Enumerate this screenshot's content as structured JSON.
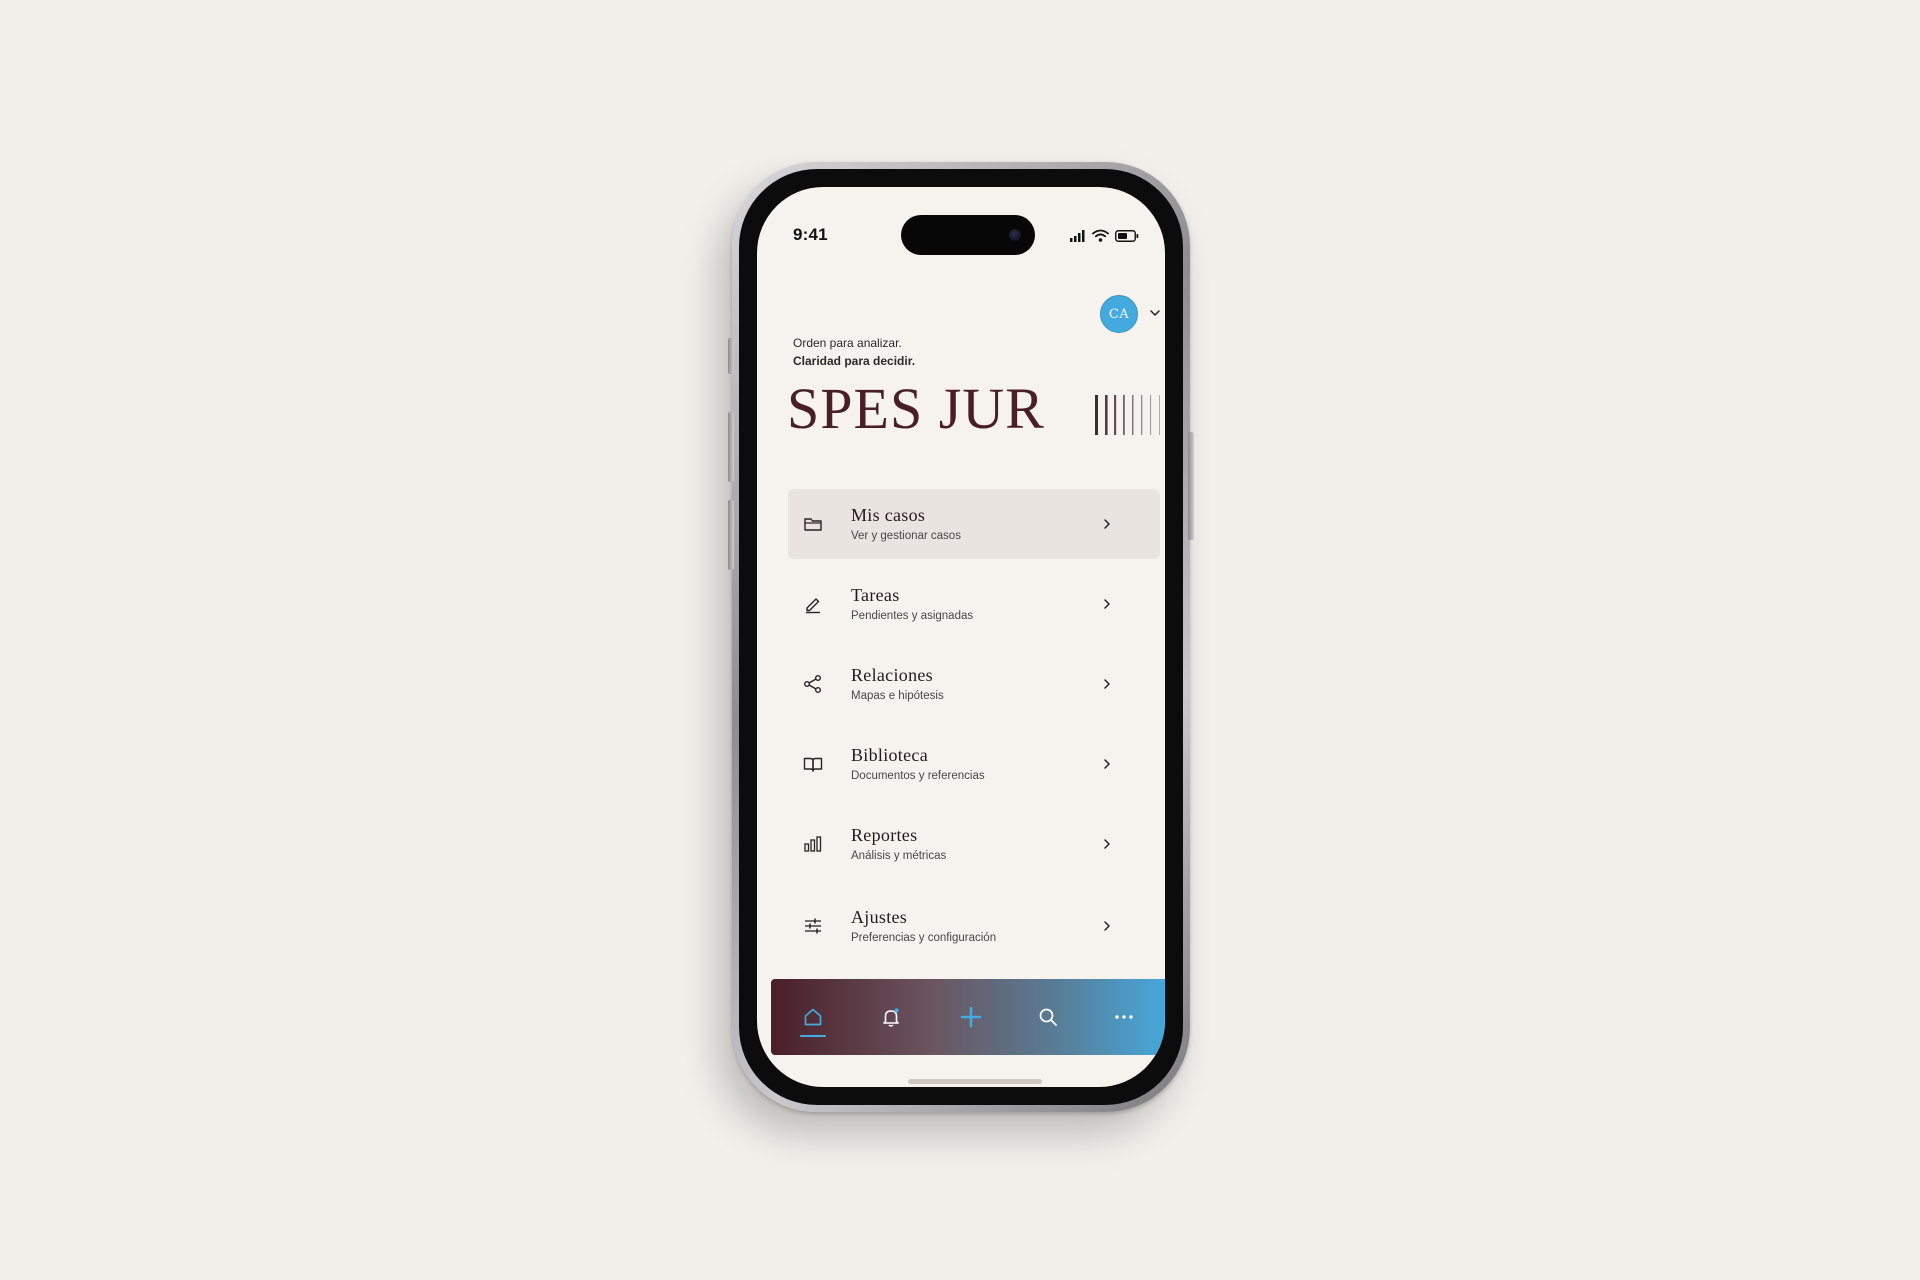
{
  "status_bar": {
    "time": "9:41"
  },
  "header": {
    "avatar_initials": "CA",
    "tagline_line1": "Orden para analizar.",
    "tagline_line2": "Claridad para decidir.",
    "brand": "SPES JUR"
  },
  "menu": {
    "items": [
      {
        "title": "Mis casos",
        "subtitle": "Ver y gestionar casos",
        "icon": "folder-icon",
        "active": true
      },
      {
        "title": "Tareas",
        "subtitle": "Pendientes y asignadas",
        "icon": "pencil-icon",
        "active": false
      },
      {
        "title": "Relaciones",
        "subtitle": "Mapas e hipótesis",
        "icon": "share-icon",
        "active": false
      },
      {
        "title": "Biblioteca",
        "subtitle": "Documentos y referencias",
        "icon": "book-icon",
        "active": false
      },
      {
        "title": "Reportes",
        "subtitle": "Análisis y métricas",
        "icon": "bar-chart-icon",
        "active": false
      },
      {
        "title": "Ajustes",
        "subtitle": "Preferencias y configuración",
        "icon": "sliders-icon",
        "active": false
      }
    ]
  },
  "tabbar": {
    "tabs": [
      "home-icon",
      "bell-icon",
      "plus-icon",
      "search-icon",
      "more-icon"
    ],
    "active_tab": "home-icon"
  },
  "colors": {
    "background": "#f3f0ec",
    "screen": "#f6f3ef",
    "brand": "#4a1e27",
    "accent": "#44aadf",
    "active_item": "#e9e4df"
  }
}
